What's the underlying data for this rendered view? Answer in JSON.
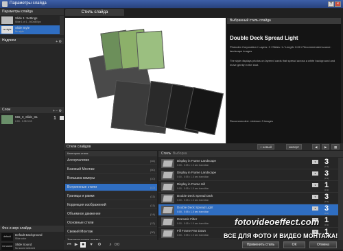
{
  "window": {
    "title": "Параметры слайда"
  },
  "left": {
    "slide_params": "Параметры слайда",
    "slides_items": [
      {
        "thumb": "",
        "line1": "Slide 1: Settings",
        "line2": "Slide 1 of 1 - 600x800px"
      },
      {
        "thumb": "no style",
        "line1": "Slide Style",
        "line2": "No style"
      }
    ],
    "captions": "Надписи",
    "layers": "Слои",
    "layer_items": [
      {
        "line1": "555_0_Slide_0a",
        "line2": "0:00 - 0:35 0:03",
        "num": "1"
      }
    ],
    "background": "Фон и звук слайда",
    "bg_items": [
      {
        "thumb": "default",
        "line1": "Default Background",
        "line2": "Slide color"
      },
      {
        "thumb": "no sound",
        "line1": "Slide Sound",
        "line2": "No sound selected"
      }
    ]
  },
  "tab": "Стиль слайда",
  "info": {
    "header": "Выбранный стиль слайда",
    "style_name": "Double Deck Spread Light",
    "p1": "Photodex Corporation / Layers: 3 / Slides: 1 / Length: 0:00 / Recommended source: landscape images",
    "p2": "The style displays photos on layered cards that spread across a white background and move gently in the shot.",
    "p3": "Recommended: minimum 3 images"
  },
  "styles_hdr": "Стили слайдов",
  "styles_btns": [
    "+ новый",
    "импорт"
  ],
  "cats": {
    "header": "Категория стиля",
    "items": [
      {
        "name": "Ассорталогия",
        "n": "(46)"
      },
      {
        "name": "Базовый Монтаж",
        "n": "(50)"
      },
      {
        "name": "Вспышка камеры",
        "n": "(10)"
      },
      {
        "name": "Встроенные стили",
        "n": "(42)"
      },
      {
        "name": "Границы и рамки",
        "n": "(11)"
      },
      {
        "name": "Коррекция изображений",
        "n": "(11)"
      },
      {
        "name": "Объемное движение",
        "n": "(14)"
      },
      {
        "name": "Основные стили",
        "n": "(12)"
      },
      {
        "name": "Свежий Монтаж",
        "n": "(30)"
      },
      {
        "name": "Тематические стили",
        "n": "(16)"
      }
    ]
  },
  "slides_list": {
    "header": "Стиль",
    "search": "Выборка",
    "rows": [
      {
        "name": "Display in Frame Landscape",
        "sub": "0:00 - 0:05 • 1.0 sec transition",
        "num": "3",
        "ctr": "(0:1)"
      },
      {
        "name": "Display in Frame Landscape",
        "sub": "0:00 - 0:05 • 1.0 sec transition",
        "num": "3",
        "ctr": "(0:1)"
      },
      {
        "name": "Display in Frame Hill",
        "sub": "0:00 - 0:05 • 1.0 sec transition",
        "num": "1",
        "ctr": "(0:1)"
      },
      {
        "name": "Double Deck Spread Dark",
        "sub": "0:00 - 0:05 • 1.0 sec transition",
        "num": "3",
        "ctr": "(0:1)"
      },
      {
        "name": "Double Deck Spread Light",
        "sub": "0:00 - 0:05 • 1.0 sec transition",
        "num": "3",
        "ctr": "(0:1)"
      },
      {
        "name": "Dramatic Filter",
        "sub": "0:00 - 0:05 • 1.0 sec transition",
        "num": "1",
        "ctr": "(0:1)"
      },
      {
        "name": "Fill Frame Pan Down",
        "sub": "0:00 - 0:05 • 1.0 sec transition",
        "num": "1",
        "ctr": "(0:1)"
      }
    ]
  },
  "footer": {
    "zoom": "0:0",
    "apply": "Применить стиль",
    "ok": "ОК",
    "cancel": "Отмена"
  },
  "watermark": {
    "line1": "fotovideoeffect.com",
    "line2": "ВСЕ ДЛЯ ФОТО И ВИДЕО МОНТАЖА!"
  },
  "colors": {
    "selected": "#2f6ec2",
    "bg": "#1b1b1b"
  }
}
